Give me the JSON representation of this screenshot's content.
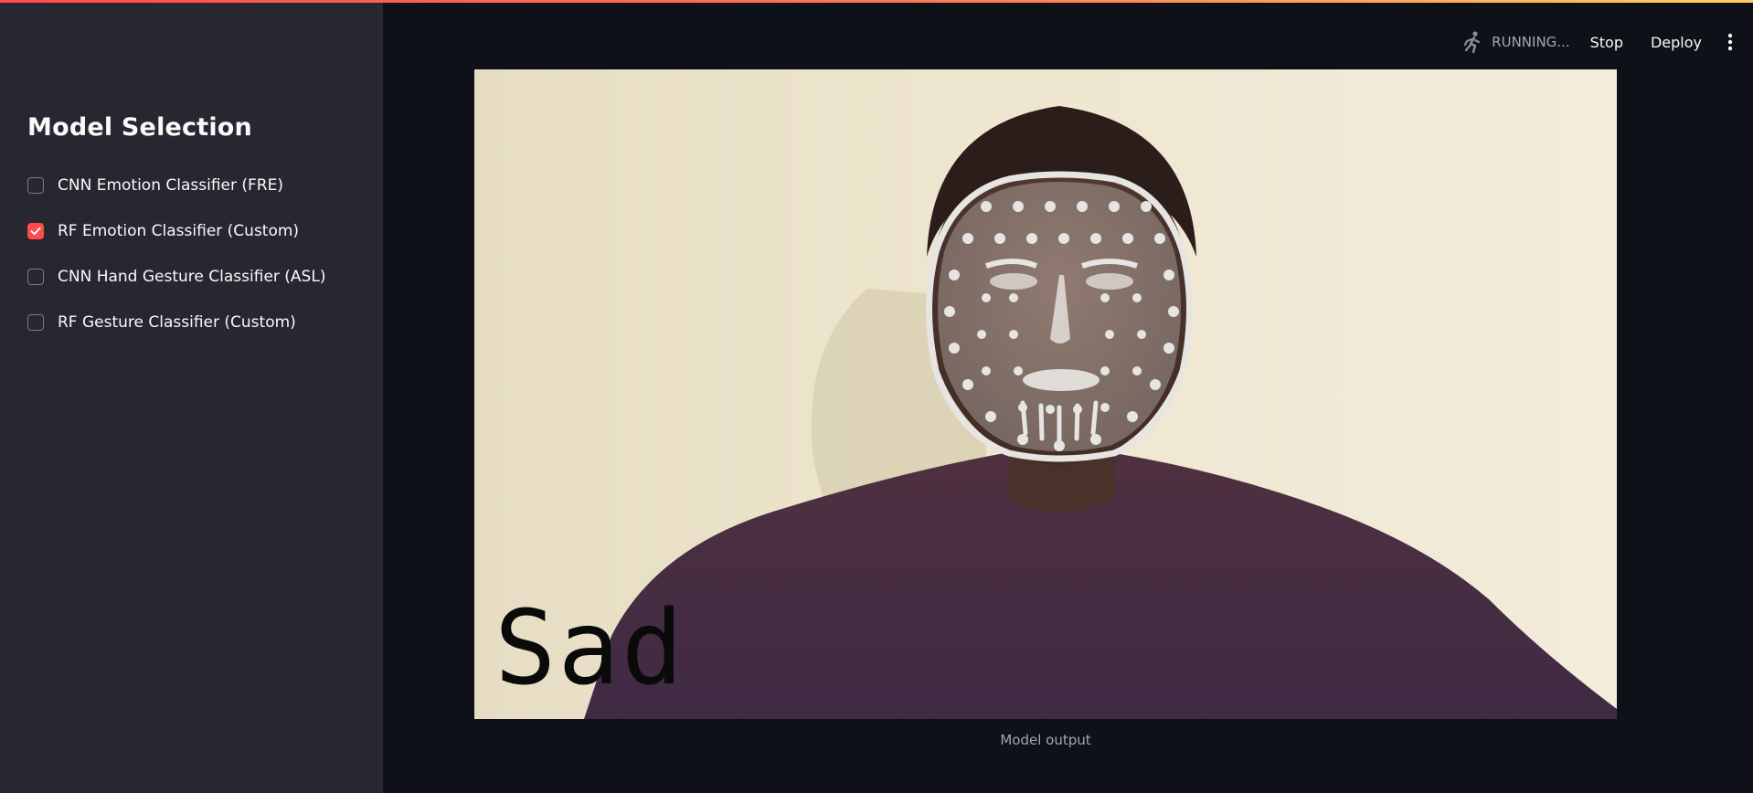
{
  "sidebar": {
    "title": "Model Selection",
    "models": [
      {
        "label": "CNN Emotion Classifier (FRE)",
        "checked": false
      },
      {
        "label": "RF Emotion Classifier (Custom)",
        "checked": true
      },
      {
        "label": "CNN Hand Gesture Classifier (ASL)",
        "checked": false
      },
      {
        "label": "RF Gesture Classifier (Custom)",
        "checked": false
      }
    ]
  },
  "header": {
    "status": "RUNNING...",
    "stop_label": "Stop",
    "deploy_label": "Deploy",
    "status_icon": "running-man-icon",
    "menu_icon": "kebab-menu-icon"
  },
  "output": {
    "emotion_label": "Sad",
    "caption": "Model output"
  },
  "colors": {
    "accent": "#ff4b4b",
    "sidebar_bg": "#262730",
    "main_bg": "#0e1117",
    "muted_text": "#a3a8b4"
  }
}
